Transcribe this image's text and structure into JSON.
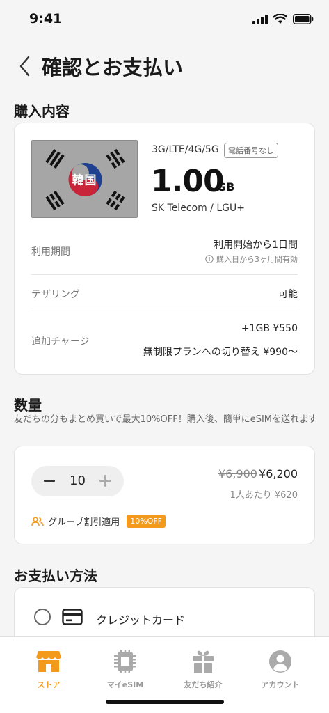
{
  "status": {
    "time": "9:41"
  },
  "header": {
    "title": "確認とお支払い"
  },
  "purchase": {
    "section_title": "購入内容",
    "flag_label": "韓国",
    "network": "3G/LTE/4G/5G",
    "badge": "電話番号なし",
    "amount": "1.00",
    "unit": "GB",
    "carrier": "SK Telecom / LGU+",
    "period_label": "利用期間",
    "period_value": "利用開始から1日間",
    "period_note": "購入日から3ヶ月間有効",
    "tethering_label": "テザリング",
    "tethering_value": "可能",
    "charge_label": "追加チャージ",
    "charge_value1": "+1GB ¥550",
    "charge_value2": "無制限プランへの切り替え ¥990〜"
  },
  "quantity": {
    "section_title": "数量",
    "description": "友だちの分もまとめ買いで最大10%OFF！購入後、簡単にeSIMを送れます",
    "value": "10",
    "price_original": "¥6,900",
    "price_new": "¥6,200",
    "price_per": "1人あたり ¥620",
    "discount_label": "グループ割引適用",
    "discount_badge": "10%OFF"
  },
  "payment": {
    "section_title": "お支払い方法",
    "option_label": "クレジットカード"
  },
  "tabs": [
    {
      "label": "ストア",
      "icon": "store-icon",
      "active": true
    },
    {
      "label": "マイeSIM",
      "icon": "chip-icon",
      "active": false
    },
    {
      "label": "友だち紹介",
      "icon": "gift-icon",
      "active": false
    },
    {
      "label": "アカウント",
      "icon": "account-icon",
      "active": false
    }
  ],
  "colors": {
    "accent": "#f39a1c",
    "flag_red": "#c8253a",
    "flag_blue": "#1f3f8f"
  }
}
